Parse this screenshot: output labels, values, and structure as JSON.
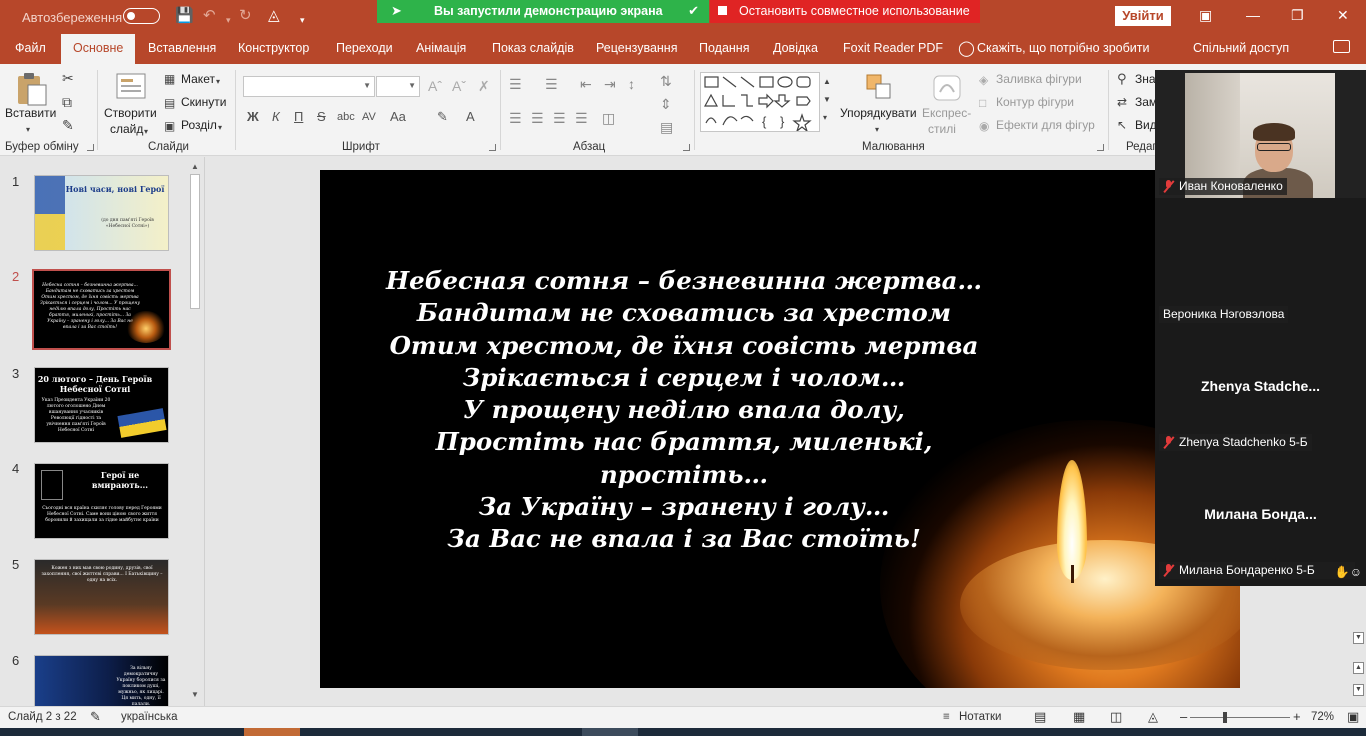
{
  "titlebar": {
    "autosave_label": "Автозбереження",
    "share_banner": "Вы запустили демонстрацию экрана",
    "stop_share": "Остановить совместное использование",
    "sign_in": "Увійти"
  },
  "tabs": [
    {
      "label": "Файл"
    },
    {
      "label": "Основне"
    },
    {
      "label": "Вставлення"
    },
    {
      "label": "Конструктор"
    },
    {
      "label": "Переходи"
    },
    {
      "label": "Анімація"
    },
    {
      "label": "Показ слайдів"
    },
    {
      "label": "Рецензування"
    },
    {
      "label": "Подання"
    },
    {
      "label": "Довідка"
    },
    {
      "label": "Foxit Reader PDF"
    }
  ],
  "tell_me": "Скажіть, що потрібно зробити",
  "share_label": "Спільний доступ",
  "ribbon": {
    "clipboard": {
      "paste": "Вставити",
      "group": "Буфер обміну"
    },
    "slides": {
      "new_slide_line1": "Створити",
      "new_slide_line2": "слайд",
      "layout": "Макет",
      "reset": "Скинути",
      "section": "Розділ",
      "group": "Слайди"
    },
    "font": {
      "group": "Шрифт",
      "bold": "Ж",
      "italic": "К",
      "underline": "П",
      "strike": "S",
      "case": "Aa"
    },
    "paragraph": {
      "group": "Абзац"
    },
    "drawing": {
      "arrange_line1": "Упорядкувати",
      "styles_line1": "Експрес-",
      "styles_line2": "стилі",
      "fill": "Заливка фігури",
      "outline": "Контур фігури",
      "effects": "Ефекти для фігур",
      "group": "Малювання"
    },
    "editing": {
      "find": "Зна",
      "replace": "Зам",
      "select": "Вид",
      "group": "Редаг"
    }
  },
  "thumbnails": [
    {
      "num": "1",
      "title": "Нові часи, нові Герої",
      "sub": "(до дня пам'яті Героїв «Небесної Сотні»)"
    },
    {
      "num": "2",
      "title": "",
      "sub": "Небесна сотня – безневинна жертва... Бандитам не сховатись за хрестом Отим хрестом, де їхня совість мертва Зрікається і серцем і чолом... У прощену неділю впала долу, Простіть нас браття, миленькі, простіть... За Україну – зранену і голу... За Вас не впала і за Вас стоїть!"
    },
    {
      "num": "3",
      "title": "20 лютого – День Героїв Небесної Сотні",
      "sub": "Указ Президента України 20 лютого оголошено Днем вшанування учасників Революції гідності та увічнення пам'яті Героїв Небесної Сотні"
    },
    {
      "num": "4",
      "title": "Герої не вмирають...",
      "sub": "Сьогодні вся країна схиляє голову перед Героями Небесної Сотні. Саме вони ціною свого життя боронили й захищали за гідне майбутнє країни"
    },
    {
      "num": "5",
      "title": "",
      "sub": "Кожен з них мав свою родину, друзів, свої захоплення, свої життєві справи... І Батьківщину – одну на всіх."
    },
    {
      "num": "6",
      "title": "",
      "sub": "За вільну демократичну Україну боролися за покликом душі, мужньо, як лицарі. Ця мить, одну, її палали."
    }
  ],
  "slide": {
    "lines": [
      "Небесная сотня – безневинна жертва…",
      "Бандитам не сховатись за хрестом",
      "Отим хрестом, де їхня совість мертва",
      "Зрікається і серцем і чолом…",
      "У прощену неділю впала долу,",
      "Простіть нас браття, миленькі,",
      "простіть…",
      "За Україну – зранену і голу…",
      "За Вас не впала і за Вас стоїть!"
    ]
  },
  "participants": [
    {
      "name": "Иван Коноваленко",
      "center": "",
      "video": true,
      "muted": true
    },
    {
      "name": "Вероника Нэговэлова",
      "center": "",
      "video": false,
      "muted": false
    },
    {
      "name": "Zhenya Stadchenko 5-Б",
      "center": "Zhenya  Stadche...",
      "video": false,
      "muted": true
    },
    {
      "name": "Милана Бондаренко 5-Б",
      "center": "Милана  Бонда...",
      "video": false,
      "muted": true
    }
  ],
  "status": {
    "slide_counter": "Слайд 2 з 22",
    "language": "українська",
    "notes": "Нотатки",
    "zoom": "72%",
    "zoom_fraction": 0.72
  },
  "colors": {
    "accent": "#b7472a",
    "share_green": "#2eb34a",
    "stop_red": "#e02424",
    "active_slide": "#c0504d"
  }
}
